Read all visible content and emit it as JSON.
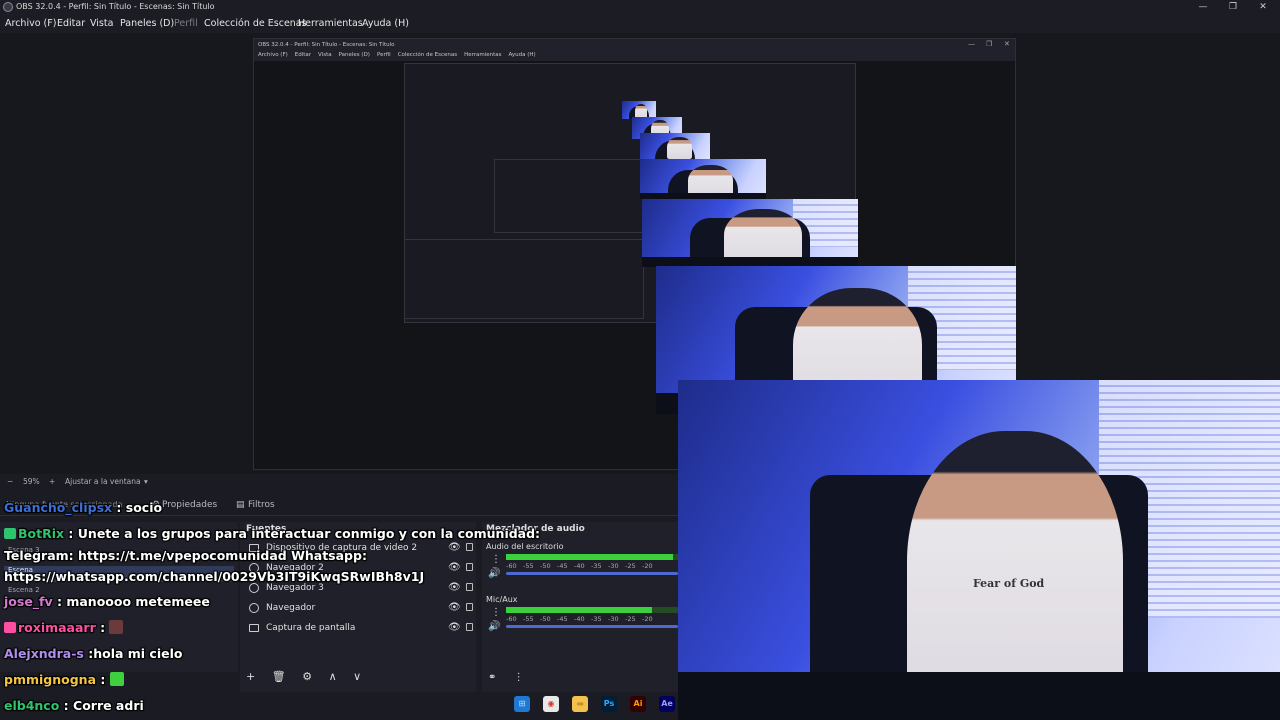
{
  "window": {
    "title": "OBS 32.0.4 - Perfil: Sin Título - Escenas: Sin Título",
    "minimize": "—",
    "restore": "❐",
    "close": "✕"
  },
  "menu": {
    "items": [
      "Archivo (F)",
      "Editar",
      "Vista",
      "Paneles (D)",
      "Perfil",
      "Colección de Escenas",
      "Herramientas",
      "Ayuda (H)"
    ]
  },
  "nested": {
    "title": "OBS 32.0.4 - Perfil: Sin Título - Escenas: Sin Título",
    "menu": "Archivo (F)    Editar    Vista    Paneles (D)    Perfil    Colección de Escenas    Herramientas    Ayuda (H)"
  },
  "zoom": {
    "minus": "−",
    "value": "59%",
    "plus": "+",
    "fit_label": "Ajustar a la ventana",
    "caret": "▾"
  },
  "tabs": {
    "no_source": "Ninguna fuente seleccionada",
    "properties": "Propiedades",
    "filters": "Filtros"
  },
  "scenes": {
    "items": [
      "Escena 3",
      "Escena",
      "Escena 2"
    ],
    "selected": 1
  },
  "sources": {
    "header": "Fuentes",
    "items": [
      {
        "label": "Dispositivo de captura de video 2",
        "icon": "camera-icon"
      },
      {
        "label": "Navegador 2",
        "icon": "globe-icon"
      },
      {
        "label": "Navegador 3",
        "icon": "globe-icon"
      },
      {
        "label": "Navegador",
        "icon": "globe-icon"
      },
      {
        "label": "Captura de pantalla",
        "icon": "monitor-icon"
      }
    ],
    "eye": "👁",
    "controls": {
      "add": "+",
      "remove": "🗑",
      "settings": "⚙",
      "up": "∧",
      "down": "∨"
    }
  },
  "mixer": {
    "header": "Mezclador de audio",
    "channels": [
      {
        "name": "Audio del escritorio",
        "level": 0.97
      },
      {
        "name": "Mic/Aux",
        "level": 0.85
      }
    ],
    "ticks": [
      "-60",
      "-55",
      "-50",
      "-45",
      "-40",
      "-35",
      "-30",
      "-25",
      "-20"
    ],
    "controls": {
      "link": "⚭",
      "menu": "⋮"
    },
    "dots": "⋮",
    "vol": "🔊"
  },
  "chat": {
    "messages": [
      {
        "user": "Guancho_clipsx",
        "text": ": socio",
        "color": "#3d6fd6"
      },
      {
        "user": "BotRix",
        "text": ": Unete a los grupos para interactuar conmigo y con la comunidad:",
        "color": "#2ec36d",
        "badge": true
      },
      {
        "user": "",
        "text": "Telegram: https://t.me/vpepocomunidad Whatsapp:",
        "color": "#ffffff"
      },
      {
        "user": "",
        "text": "https://whatsapp.com/channel/0029Vb3IT9iKwqSRwIBh8v1J",
        "color": "#ffffff"
      },
      {
        "user": "jose_fv",
        "text": ": manoooo metemeee",
        "color": "#d47ad0"
      },
      {
        "user": "roximaaarr",
        "text": ":",
        "color": "#ff4fa3",
        "emote": "#6b3a3a",
        "badge": true
      },
      {
        "user": "Alejxndra-s",
        "text": ":hola mi cielo",
        "color": "#b08df0"
      },
      {
        "user": "pmmignogna",
        "text": ":",
        "color": "#f5c542",
        "emote": "#3fcf3f"
      },
      {
        "user": "elb4nco",
        "text": ": Corre adri",
        "color": "#2ec36d"
      }
    ]
  },
  "camera": {
    "shirt_text": "Fear of God"
  },
  "taskbar": {
    "items": [
      {
        "name": "windows-start-icon",
        "glyph": "⊞",
        "bg": "#1f78d1",
        "fg": "#9fd4ff"
      },
      {
        "name": "chrome-icon",
        "glyph": "◉",
        "bg": "#e8e8e8",
        "fg": "#d23b2b"
      },
      {
        "name": "folder-icon",
        "glyph": "▬",
        "bg": "#f2c14e",
        "fg": "#c49223"
      },
      {
        "name": "photoshop-icon",
        "glyph": "Ps",
        "bg": "#001e36",
        "fg": "#31a8ff"
      },
      {
        "name": "illustrator-icon",
        "glyph": "Ai",
        "bg": "#330000",
        "fg": "#ff9a00"
      },
      {
        "name": "after-effects-icon",
        "glyph": "Ae",
        "bg": "#00005b",
        "fg": "#9999ff"
      }
    ]
  }
}
